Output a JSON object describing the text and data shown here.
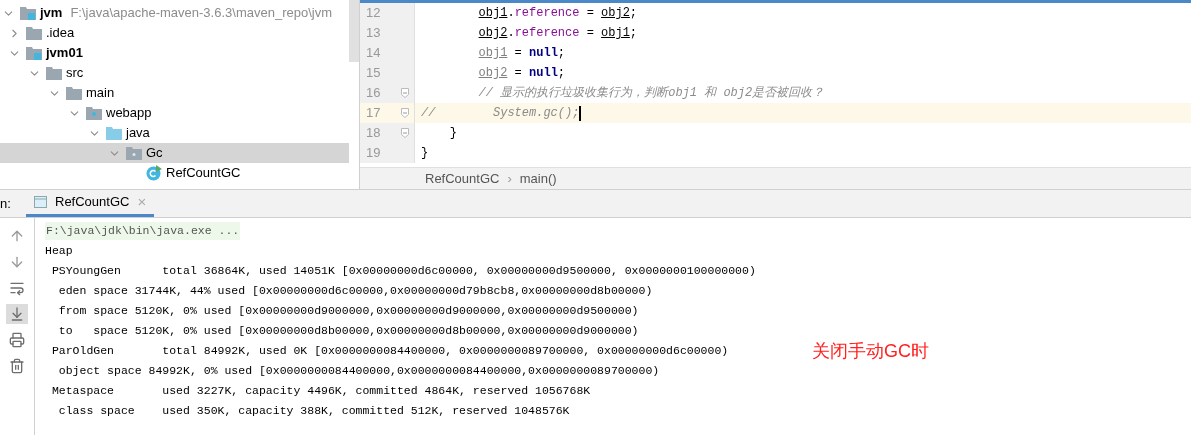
{
  "project_tree": {
    "items": [
      {
        "label": "jvm",
        "path": "F:\\java\\apache-maven-3.6.3\\maven_repo\\jvm",
        "kind": "module",
        "bold": true,
        "expanded": true,
        "selected": false,
        "children": [
          {
            "label": ".idea",
            "kind": "folder",
            "bold": false,
            "expanded": false,
            "selected": false
          },
          {
            "label": "jvm01",
            "kind": "module",
            "bold": true,
            "expanded": true,
            "selected": false,
            "children": [
              {
                "label": "src",
                "kind": "folder",
                "bold": false,
                "expanded": true,
                "selected": false,
                "children": [
                  {
                    "label": "main",
                    "kind": "folder",
                    "bold": false,
                    "expanded": true,
                    "selected": false,
                    "children": [
                      {
                        "label": "webapp",
                        "kind": "webfolder",
                        "bold": false,
                        "expanded": true,
                        "selected": false,
                        "children": [
                          {
                            "label": "java",
                            "kind": "source",
                            "bold": false,
                            "expanded": true,
                            "selected": false,
                            "children": [
                              {
                                "label": "Gc",
                                "kind": "package",
                                "bold": false,
                                "expanded": true,
                                "selected": true,
                                "children": [
                                  {
                                    "label": "RefCountGC",
                                    "kind": "class",
                                    "bold": false,
                                    "selected": false
                                  }
                                ]
                              }
                            ]
                          }
                        ]
                      }
                    ]
                  }
                ]
              }
            ]
          }
        ]
      }
    ]
  },
  "editor": {
    "lines": [
      {
        "number": "12",
        "current": false,
        "fold": false,
        "kind": "statement",
        "tokens": [
          {
            "kind": "var",
            "text": "obj1"
          },
          {
            "kind": "plain",
            "text": "."
          },
          {
            "kind": "field",
            "text": "reference"
          },
          {
            "kind": "plain",
            "text": " = "
          },
          {
            "kind": "var",
            "text": "obj2"
          },
          {
            "kind": "plain",
            "text": ";"
          }
        ]
      },
      {
        "number": "13",
        "current": false,
        "fold": false,
        "kind": "statement",
        "tokens": [
          {
            "kind": "var",
            "text": "obj2"
          },
          {
            "kind": "plain",
            "text": "."
          },
          {
            "kind": "field",
            "text": "reference"
          },
          {
            "kind": "plain",
            "text": " = "
          },
          {
            "kind": "var",
            "text": "obj1"
          },
          {
            "kind": "plain",
            "text": ";"
          }
        ]
      },
      {
        "number": "14",
        "current": false,
        "fold": false,
        "kind": "statement",
        "tokens": [
          {
            "kind": "unused",
            "text": "obj1"
          },
          {
            "kind": "plain",
            "text": " = "
          },
          {
            "kind": "keyword",
            "text": "null"
          },
          {
            "kind": "plain",
            "text": ";"
          }
        ]
      },
      {
        "number": "15",
        "current": false,
        "fold": false,
        "kind": "statement",
        "tokens": [
          {
            "kind": "unused",
            "text": "obj2"
          },
          {
            "kind": "plain",
            "text": " = "
          },
          {
            "kind": "keyword",
            "text": "null"
          },
          {
            "kind": "plain",
            "text": ";"
          }
        ]
      },
      {
        "number": "16",
        "current": false,
        "fold": true,
        "kind": "statement",
        "tokens": [
          {
            "kind": "comment",
            "text": "// 显示的执行垃圾收集行为，判断obj1 和 obj2是否被回收？"
          }
        ]
      },
      {
        "number": "17",
        "current": true,
        "fold": true,
        "kind": "commented-out",
        "tokens": [
          {
            "kind": "comment",
            "text": "//        System.gc();"
          }
        ]
      },
      {
        "number": "18",
        "current": false,
        "fold": true,
        "kind": "method-end",
        "tokens": [
          {
            "kind": "brace",
            "text": "}"
          }
        ]
      },
      {
        "number": "19",
        "current": false,
        "fold": false,
        "kind": "class-end",
        "tokens": [
          {
            "kind": "brace",
            "text": "}"
          }
        ]
      }
    ],
    "breadcrumbs": [
      "RefCountGC",
      "main()"
    ],
    "breadcrumb_separator": "›"
  },
  "run_panel": {
    "label": "n:",
    "tabs": [
      {
        "label": "RefCountGC",
        "selected": true,
        "close": "×"
      }
    ],
    "toolbar": [
      {
        "kind": "up",
        "toggled": false
      },
      {
        "kind": "down",
        "toggled": false
      },
      {
        "kind": "wrap",
        "toggled": false
      },
      {
        "kind": "scroll-end",
        "toggled": true
      },
      {
        "kind": "print",
        "toggled": false
      },
      {
        "kind": "trash",
        "toggled": false
      }
    ],
    "console": [
      {
        "kind": "command",
        "text": "F:\\java\\jdk\\bin\\java.exe ..."
      },
      {
        "kind": "output",
        "text": "Heap"
      },
      {
        "kind": "output",
        "text": " PSYoungGen      total 36864K, used 14051K [0x00000000d6c00000, 0x00000000d9500000, 0x0000000100000000)"
      },
      {
        "kind": "output",
        "text": "  eden space 31744K, 44% used [0x00000000d6c00000,0x00000000d79b8cb8,0x00000000d8b00000)"
      },
      {
        "kind": "output",
        "text": "  from space 5120K, 0% used [0x00000000d9000000,0x00000000d9000000,0x00000000d9500000)"
      },
      {
        "kind": "output",
        "text": "  to   space 5120K, 0% used [0x00000000d8b00000,0x00000000d8b00000,0x00000000d9000000)"
      },
      {
        "kind": "output",
        "text": " ParOldGen       total 84992K, used 0K [0x0000000084400000, 0x0000000089700000, 0x00000000d6c00000)"
      },
      {
        "kind": "output",
        "text": "  object space 84992K, 0% used [0x0000000084400000,0x0000000084400000,0x0000000089700000)"
      },
      {
        "kind": "output",
        "text": " Metaspace       used 3227K, capacity 4496K, committed 4864K, reserved 1056768K"
      },
      {
        "kind": "output",
        "text": "  class space    used 350K, capacity 388K, committed 512K, reserved 1048576K"
      }
    ]
  },
  "annotation": "关闭手动GC时"
}
